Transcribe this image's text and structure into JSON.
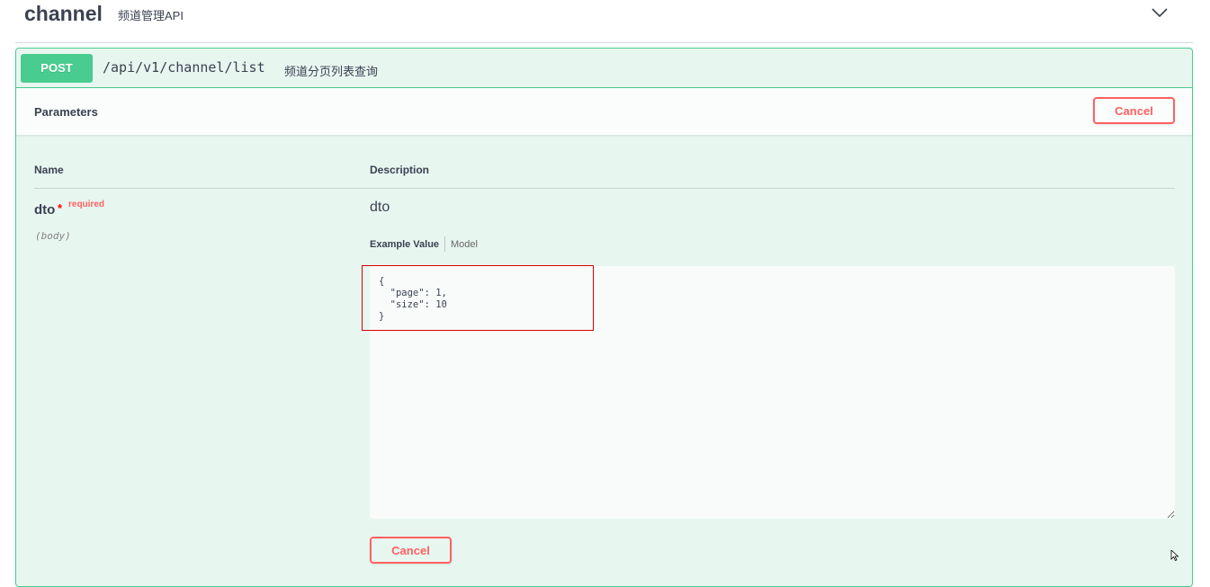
{
  "tag": {
    "name": "channel",
    "description": "频道管理API",
    "toggle_icon": "chevron-down-icon"
  },
  "operation": {
    "method": "POST",
    "path": "/api/v1/channel/list",
    "summary": "频道分页列表查询",
    "colors": {
      "method_bg": "#49cc90",
      "block_bg": "#e8f6f0",
      "cancel": "#ff6060"
    }
  },
  "parameters": {
    "title": "Parameters",
    "cancel_label": "Cancel",
    "columns": {
      "name": "Name",
      "description": "Description"
    },
    "items": [
      {
        "name": "dto",
        "required_star": "*",
        "required_label": "required",
        "in": "(body)",
        "description": "dto",
        "tabs": {
          "example": "Example Value",
          "model": "Model"
        },
        "body_value": "{\n  \"page\": 1,\n  \"size\": 10\n}"
      }
    ],
    "bottom_cancel_label": "Cancel"
  }
}
